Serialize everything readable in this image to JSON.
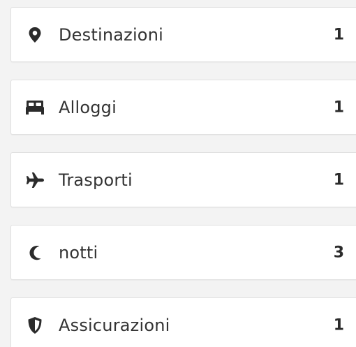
{
  "colors": {
    "background": "#f3f3f3",
    "card": "#ffffff",
    "icon": "#2b2b2b",
    "text": "#333333"
  },
  "summary": {
    "items": [
      {
        "icon": "map-marker-icon",
        "label": "Destinazioni",
        "count": "1"
      },
      {
        "icon": "bed-icon",
        "label": "Alloggi",
        "count": "1"
      },
      {
        "icon": "plane-icon",
        "label": "Trasporti",
        "count": "1"
      },
      {
        "icon": "moon-icon",
        "label": "notti",
        "count": "3"
      },
      {
        "icon": "shield-icon",
        "label": "Assicurazioni",
        "count": "1"
      }
    ]
  }
}
